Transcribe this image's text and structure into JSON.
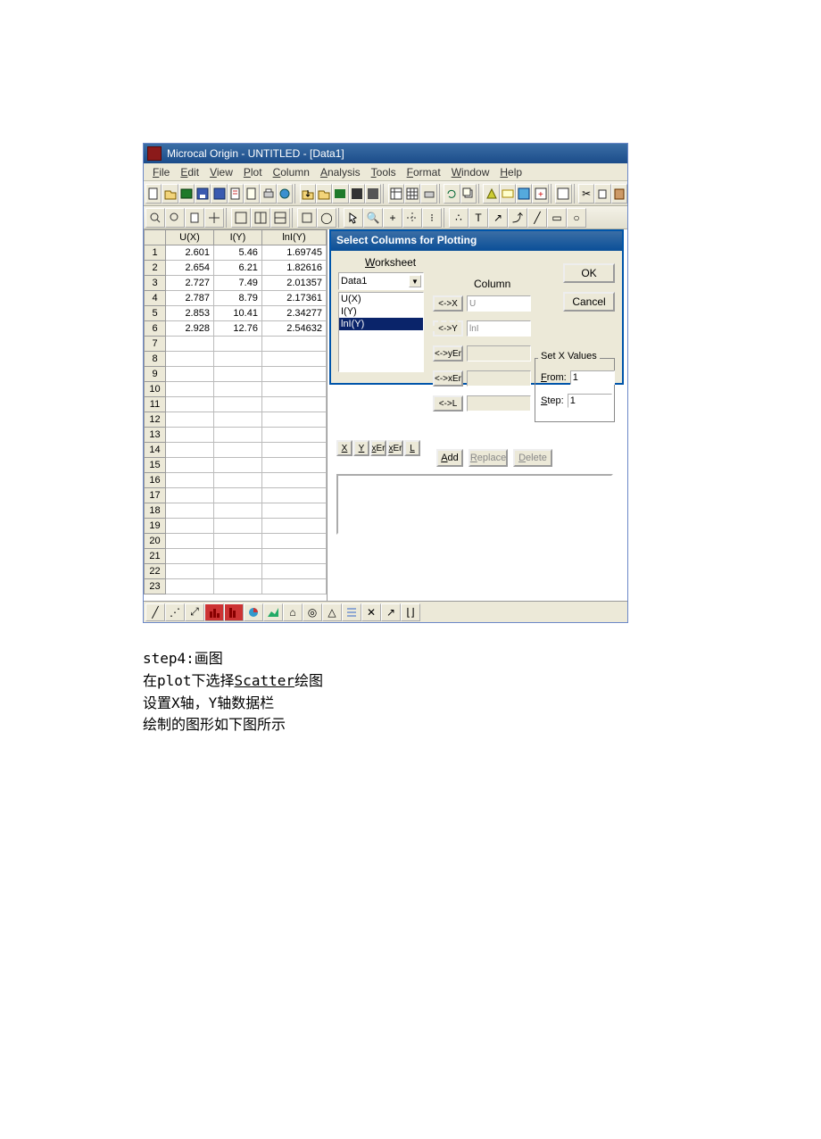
{
  "title": "Microcal Origin - UNTITLED - [Data1]",
  "menu": [
    "File",
    "Edit",
    "View",
    "Plot",
    "Column",
    "Analysis",
    "Tools",
    "Format",
    "Window",
    "Help"
  ],
  "sheet": {
    "headers": [
      "U(X)",
      "I(Y)",
      "lnI(Y)"
    ],
    "rows": [
      {
        "n": "1",
        "c": [
          "2.601",
          "5.46",
          "1.69745"
        ]
      },
      {
        "n": "2",
        "c": [
          "2.654",
          "6.21",
          "1.82616"
        ]
      },
      {
        "n": "3",
        "c": [
          "2.727",
          "7.49",
          "2.01357"
        ]
      },
      {
        "n": "4",
        "c": [
          "2.787",
          "8.79",
          "2.17361"
        ]
      },
      {
        "n": "5",
        "c": [
          "2.853",
          "10.41",
          "2.34277"
        ]
      },
      {
        "n": "6",
        "c": [
          "2.928",
          "12.76",
          "2.54632"
        ]
      },
      {
        "n": "7",
        "c": [
          "",
          "",
          ""
        ]
      },
      {
        "n": "8",
        "c": [
          "",
          "",
          ""
        ]
      },
      {
        "n": "9",
        "c": [
          "",
          "",
          ""
        ]
      },
      {
        "n": "10",
        "c": [
          "",
          "",
          ""
        ]
      },
      {
        "n": "11",
        "c": [
          "",
          "",
          ""
        ]
      },
      {
        "n": "12",
        "c": [
          "",
          "",
          ""
        ]
      },
      {
        "n": "13",
        "c": [
          "",
          "",
          ""
        ]
      },
      {
        "n": "14",
        "c": [
          "",
          "",
          ""
        ]
      },
      {
        "n": "15",
        "c": [
          "",
          "",
          ""
        ]
      },
      {
        "n": "16",
        "c": [
          "",
          "",
          ""
        ]
      },
      {
        "n": "17",
        "c": [
          "",
          "",
          ""
        ]
      },
      {
        "n": "18",
        "c": [
          "",
          "",
          ""
        ]
      },
      {
        "n": "19",
        "c": [
          "",
          "",
          ""
        ]
      },
      {
        "n": "20",
        "c": [
          "",
          "",
          ""
        ]
      },
      {
        "n": "21",
        "c": [
          "",
          "",
          ""
        ]
      },
      {
        "n": "22",
        "c": [
          "",
          "",
          ""
        ]
      },
      {
        "n": "23",
        "c": [
          "",
          "",
          ""
        ]
      }
    ]
  },
  "dialog": {
    "title": "Select Columns for Plotting",
    "worksheet_label": "Worksheet",
    "worksheet_value": "Data1",
    "columns": [
      "U(X)",
      "I(Y)",
      "lnI(Y)"
    ],
    "column_label": "Column",
    "arrows": {
      "x": "<->X",
      "y": "<->Y",
      "yer": "<->yEr",
      "xer": "<->xEr",
      "l": "<->L"
    },
    "x_val": "U",
    "y_val": "lnI",
    "setx_label": "Set X Values",
    "from_label": "From:",
    "from_val": "1",
    "step_label": "Step:",
    "step_val": "1",
    "xyz": [
      "X",
      "Y",
      "xEr",
      "xEr",
      "L"
    ],
    "add": "Add",
    "replace": "Replace",
    "delete": "Delete",
    "ok": "OK",
    "cancel": "Cancel"
  },
  "instructions": {
    "l1": "step4:画图",
    "l2a": "在plot下选择",
    "l2b": "Scatter",
    "l2c": "绘图",
    "l3": "设置X轴，Y轴数据栏",
    "l4": "绘制的图形如下图所示"
  }
}
